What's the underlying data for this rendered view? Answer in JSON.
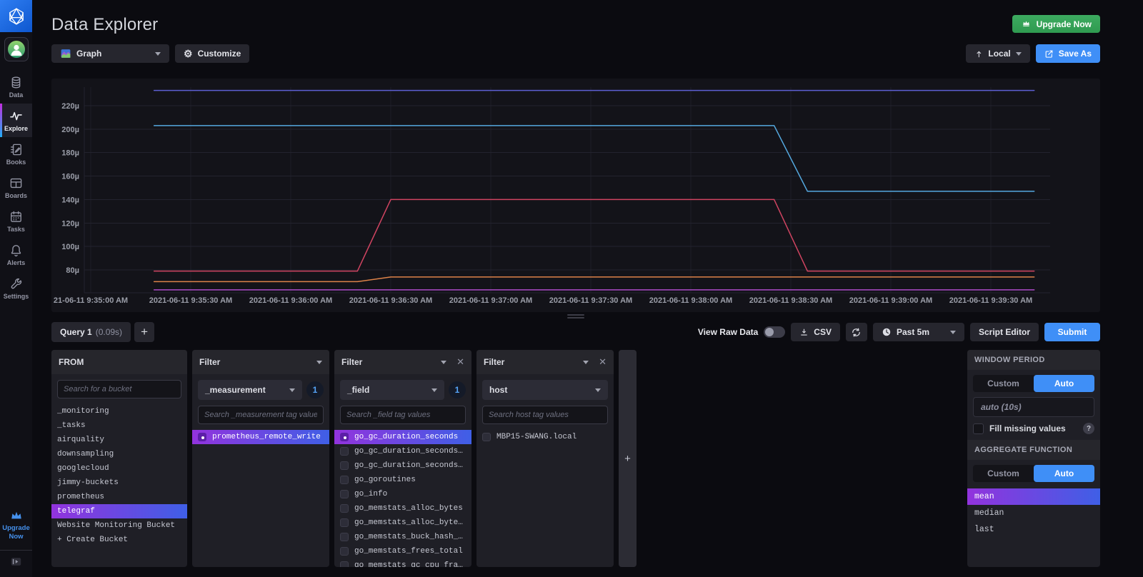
{
  "app": {
    "title": "Data Explorer",
    "upgrade_now": "Upgrade Now"
  },
  "sidebar": {
    "nav": [
      {
        "label": "Data",
        "icon": "database-icon",
        "active": false
      },
      {
        "label": "Explore",
        "icon": "graph-line-icon",
        "active": true
      },
      {
        "label": "Books",
        "icon": "notebook-icon",
        "active": false
      },
      {
        "label": "Boards",
        "icon": "dashboard-icon",
        "active": false
      },
      {
        "label": "Tasks",
        "icon": "calendar-icon",
        "active": false
      },
      {
        "label": "Alerts",
        "icon": "bell-icon",
        "active": false
      },
      {
        "label": "Settings",
        "icon": "wrench-icon",
        "active": false
      }
    ],
    "upgrade_label": "Upgrade Now"
  },
  "view_toolbar": {
    "view_type": "Graph",
    "customize": "Customize",
    "timezone": "Local",
    "save_as": "Save As"
  },
  "chart_data": {
    "type": "line",
    "y_unit": "microseconds",
    "y_ticks": [
      220,
      200,
      180,
      160,
      140,
      120,
      100,
      80
    ],
    "y_tick_labels": [
      "220µ",
      "200µ",
      "180µ",
      "160µ",
      "140µ",
      "120µ",
      "100µ",
      "80µ"
    ],
    "x_tick_seconds": [
      0,
      30,
      60,
      90,
      120,
      150,
      180,
      210,
      240,
      270
    ],
    "x_tick_labels": [
      "21-06-11 9:35:00 AM",
      "2021-06-11 9:35:30 AM",
      "2021-06-11 9:36:00 AM",
      "2021-06-11 9:36:30 AM",
      "2021-06-11 9:37:00 AM",
      "2021-06-11 9:37:30 AM",
      "2021-06-11 9:38:00 AM",
      "2021-06-11 9:38:30 AM",
      "2021-06-11 9:39:00 AM",
      "2021-06-11 9:39:30 AM"
    ],
    "ylim": [
      60,
      237
    ],
    "xlim_seconds": [
      -2,
      288
    ],
    "grid": true,
    "legend": "none",
    "series": [
      {
        "color": "#5d60d3",
        "points": [
          [
            19,
            233
          ],
          [
            283,
            233
          ]
        ]
      },
      {
        "color": "#55a9e0",
        "points": [
          [
            19,
            203
          ],
          [
            205,
            203
          ],
          [
            215,
            147
          ],
          [
            283,
            147
          ]
        ]
      },
      {
        "color": "#d04461",
        "points": [
          [
            19,
            79
          ],
          [
            80,
            79
          ],
          [
            90,
            140
          ],
          [
            205,
            140
          ],
          [
            215,
            79
          ],
          [
            283,
            79
          ]
        ]
      },
      {
        "color": "#dd8349",
        "points": [
          [
            19,
            70
          ],
          [
            80,
            70
          ],
          [
            90,
            74
          ],
          [
            283,
            74
          ]
        ]
      },
      {
        "color": "#ad4cc9",
        "points": [
          [
            19,
            63
          ],
          [
            283,
            63
          ]
        ]
      }
    ]
  },
  "query_toolbar": {
    "tab_label": "Query 1",
    "tab_duration": "(0.09s)",
    "add_tab": "+",
    "view_raw_data": "View Raw Data",
    "raw_toggle_on": false,
    "csv": "CSV",
    "time_range": "Past 5m",
    "script_editor": "Script Editor",
    "submit": "Submit"
  },
  "from_panel": {
    "title": "FROM",
    "search_placeholder": "Search for a bucket",
    "buckets": [
      "_monitoring",
      "_tasks",
      "airquality",
      "downsampling",
      "googlecloud",
      "jimmy-buckets",
      "prometheus",
      "telegraf",
      "Website Monitoring Bucket",
      "+ Create Bucket"
    ],
    "selected_bucket": "telegraf"
  },
  "filters": [
    {
      "title": "Filter",
      "tag_key": "_measurement",
      "count_badge": "1",
      "closable": false,
      "search_placeholder": "Search _measurement tag values",
      "items": [
        {
          "label": "prometheus_remote_write",
          "checked": true,
          "selected": true
        }
      ]
    },
    {
      "title": "Filter",
      "tag_key": "_field",
      "count_badge": "1",
      "closable": true,
      "search_placeholder": "Search _field tag values",
      "items": [
        {
          "label": "go_gc_duration_seconds",
          "checked": true,
          "selected": true
        },
        {
          "label": "go_gc_duration_seconds_co…",
          "checked": false,
          "selected": false
        },
        {
          "label": "go_gc_duration_seconds_sum",
          "checked": false,
          "selected": false
        },
        {
          "label": "go_goroutines",
          "checked": false,
          "selected": false
        },
        {
          "label": "go_info",
          "checked": false,
          "selected": false
        },
        {
          "label": "go_memstats_alloc_bytes",
          "checked": false,
          "selected": false
        },
        {
          "label": "go_memstats_alloc_bytes_t…",
          "checked": false,
          "selected": false
        },
        {
          "label": "go_memstats_buck_hash_sys…",
          "checked": false,
          "selected": false
        },
        {
          "label": "go_memstats_frees_total",
          "checked": false,
          "selected": false
        },
        {
          "label": "go_memstats_gc_cpu_fracti…",
          "checked": false,
          "selected": false
        }
      ]
    },
    {
      "title": "Filter",
      "tag_key": "host",
      "count_badge": null,
      "closable": true,
      "search_placeholder": "Search host tag values",
      "items": [
        {
          "label": "MBP15-SWANG.local",
          "checked": false,
          "selected": false
        }
      ]
    }
  ],
  "add_filter": "+",
  "right_panel": {
    "window_period_title": "WINDOW PERIOD",
    "custom": "Custom",
    "auto": "Auto",
    "window_value": "auto (10s)",
    "fill_missing": "Fill missing values",
    "help": "?",
    "aggregate_title": "AGGREGATE FUNCTION",
    "functions": [
      "mean",
      "median",
      "last"
    ],
    "selected_function": "mean"
  }
}
